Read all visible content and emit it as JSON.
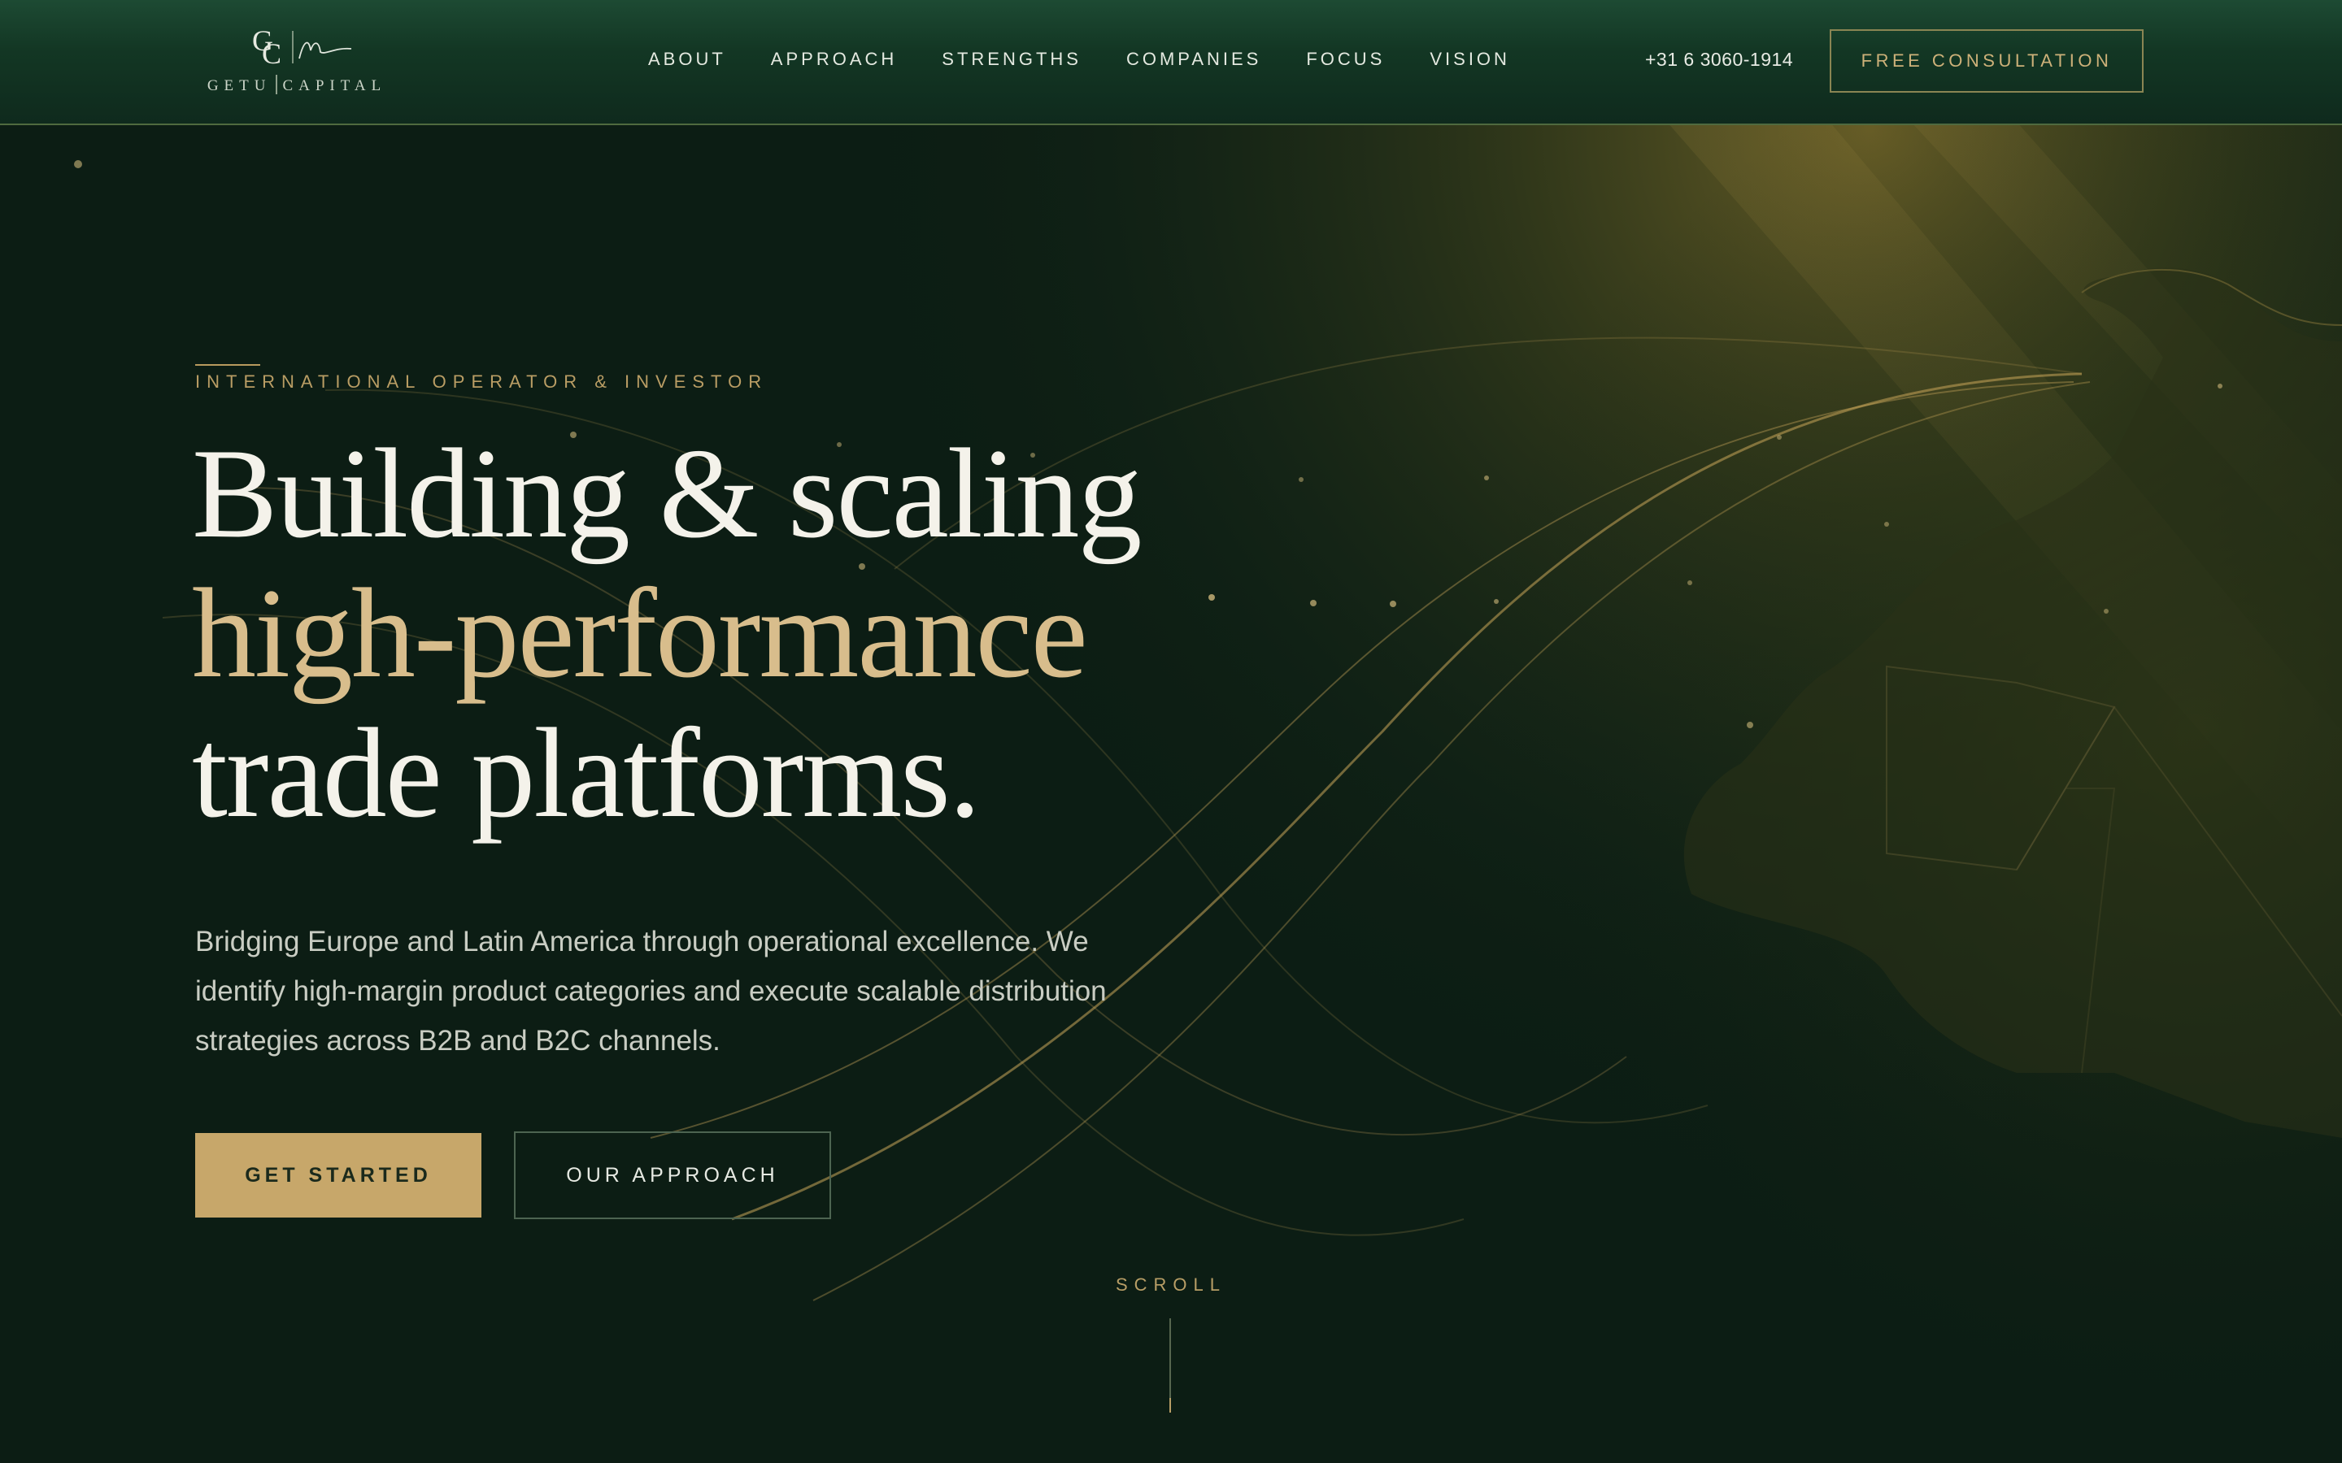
{
  "brand": {
    "monogram": "GC",
    "name_left": "GETU",
    "name_right": "CAPITAL"
  },
  "nav": {
    "items": [
      {
        "label": "ABOUT"
      },
      {
        "label": "APPROACH"
      },
      {
        "label": "STRENGTHS"
      },
      {
        "label": "COMPANIES"
      },
      {
        "label": "FOCUS"
      },
      {
        "label": "VISION"
      }
    ],
    "phone": "+31 6 3060-1914",
    "cta_label": "FREE CONSULTATION"
  },
  "hero": {
    "eyebrow": "INTERNATIONAL OPERATOR & INVESTOR",
    "headline_line1": "Building & scaling",
    "headline_line2": "high-performance",
    "headline_line3": "trade platforms.",
    "lede": "Bridging Europe and Latin America through operational excellence. We identify high-margin product categories and execute scalable distribution strategies across B2B and B2C channels.",
    "primary_cta": "GET STARTED",
    "secondary_cta": "OUR APPROACH",
    "scroll_label": "SCROLL"
  },
  "colors": {
    "background": "#0c1d14",
    "header": "#133724",
    "gold": "#c7a76a",
    "accent_text": "#d8bd8c",
    "body_text": "#c9cdc3"
  },
  "icons": {
    "logo": "monogram-signature-icon",
    "background": "world-map-light-arcs"
  }
}
